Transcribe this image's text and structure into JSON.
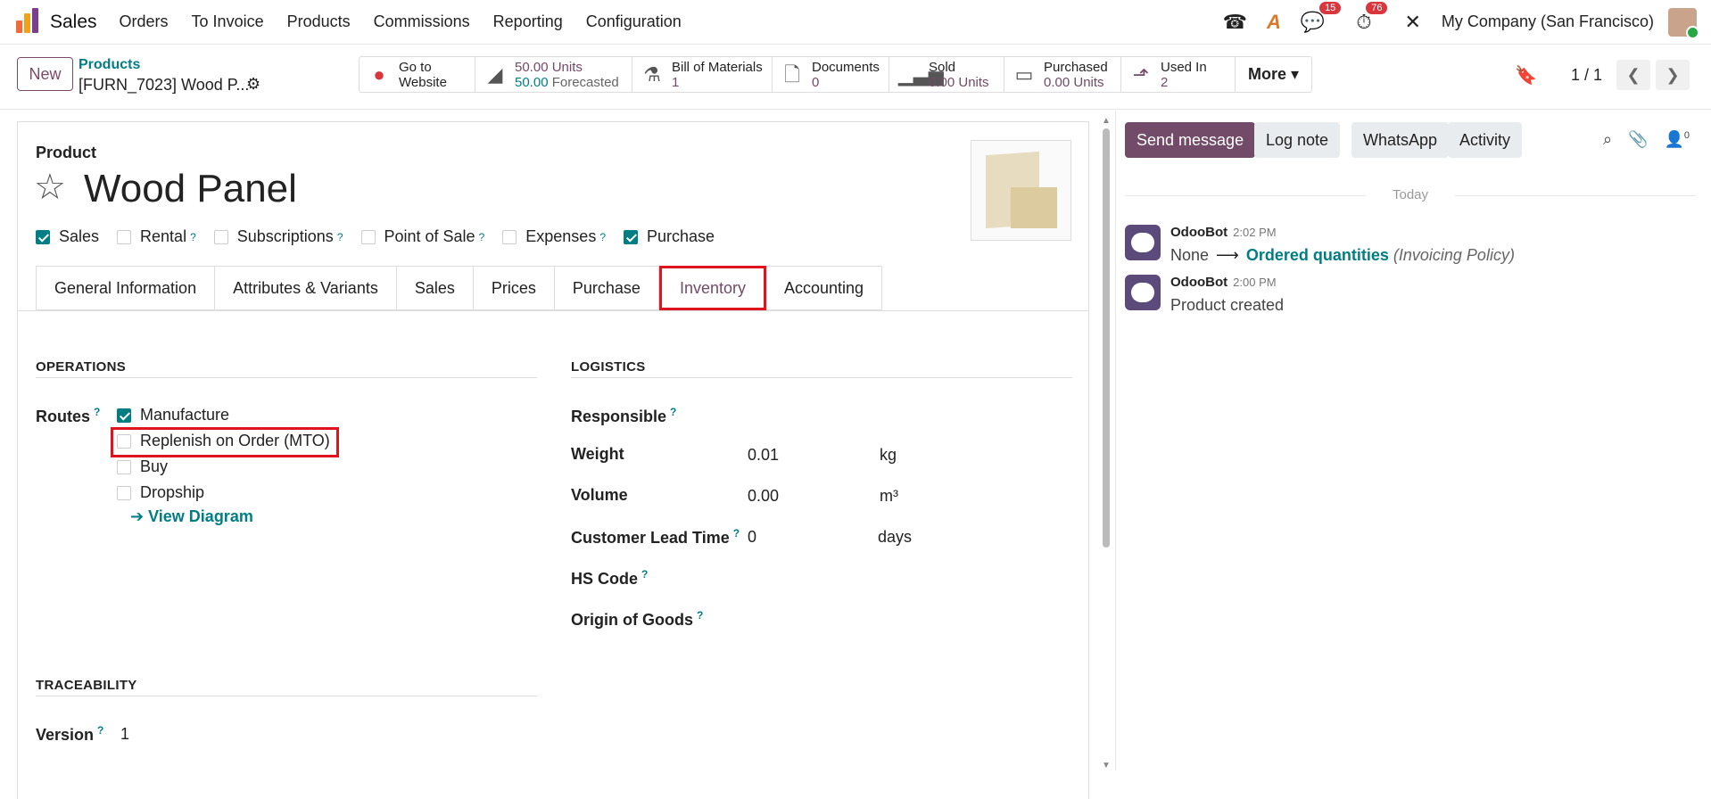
{
  "topbar": {
    "app_name": "Sales",
    "menu": [
      "Orders",
      "To Invoice",
      "Products",
      "Commissions",
      "Reporting",
      "Configuration"
    ],
    "messages_badge": "15",
    "activities_badge": "76",
    "company": "My Company (San Francisco)"
  },
  "control_panel": {
    "new_label": "New",
    "breadcrumb_parent": "Products",
    "breadcrumb_current": "[FURN_7023] Wood P...",
    "stats": [
      {
        "icon": "globe-icon",
        "line1": "Go to",
        "line2": "Website"
      },
      {
        "icon": "area-chart-icon",
        "line1": "50.00 Units",
        "line2_value": "50.00",
        "line2_label": "Forecasted"
      },
      {
        "icon": "flask-icon",
        "line1": "Bill of Materials",
        "line2": "1"
      },
      {
        "icon": "document-icon",
        "line1": "Documents",
        "line2": "0"
      },
      {
        "icon": "bar-chart-icon",
        "line1": "Sold",
        "line2": "0.00 Units"
      },
      {
        "icon": "credit-card-icon",
        "line1": "Purchased",
        "line2": "0.00 Units"
      },
      {
        "icon": "level-up-icon",
        "line1": "Used In",
        "line2": "2"
      }
    ],
    "more_label": "More",
    "pager": "1 / 1"
  },
  "form": {
    "product_label": "Product",
    "product_name": "Wood Panel",
    "checkboxes": [
      {
        "label": "Sales",
        "checked": true,
        "help": false
      },
      {
        "label": "Rental",
        "checked": false,
        "help": true
      },
      {
        "label": "Subscriptions",
        "checked": false,
        "help": true
      },
      {
        "label": "Point of Sale",
        "checked": false,
        "help": true
      },
      {
        "label": "Expenses",
        "checked": false,
        "help": true
      },
      {
        "label": "Purchase",
        "checked": true,
        "help": false
      }
    ],
    "tabs": [
      "General Information",
      "Attributes & Variants",
      "Sales",
      "Prices",
      "Purchase",
      "Inventory",
      "Accounting"
    ],
    "active_tab": "Inventory",
    "operations_title": "OPERATIONS",
    "routes_label": "Routes",
    "routes": [
      {
        "label": "Manufacture",
        "checked": true
      },
      {
        "label": "Replenish on Order (MTO)",
        "checked": false
      },
      {
        "label": "Buy",
        "checked": false
      },
      {
        "label": "Dropship",
        "checked": false
      }
    ],
    "view_diagram": "View Diagram",
    "logistics_title": "LOGISTICS",
    "logistics": {
      "responsible_label": "Responsible",
      "weight_label": "Weight",
      "weight_value": "0.01",
      "weight_unit": "kg",
      "volume_label": "Volume",
      "volume_value": "0.00",
      "volume_unit": "m³",
      "lead_label": "Customer Lead Time",
      "lead_value": "0",
      "lead_unit": "days",
      "hs_label": "HS Code",
      "origin_label": "Origin of Goods"
    },
    "traceability_title": "TRACEABILITY",
    "version_label": "Version",
    "version_value": "1"
  },
  "chatter": {
    "send_message": "Send message",
    "log_note": "Log note",
    "whatsapp": "WhatsApp",
    "activity": "Activity",
    "followers_count": "0",
    "today": "Today",
    "messages": [
      {
        "author": "OdooBot",
        "time": "2:02 PM",
        "old": "None",
        "new": "Ordered quantities",
        "field": "(Invoicing Policy)"
      },
      {
        "author": "OdooBot",
        "time": "2:00 PM",
        "body": "Product created"
      }
    ]
  },
  "colors": {
    "primary": "#714b67",
    "teal": "#017e84",
    "highlight": "#e0141e"
  }
}
